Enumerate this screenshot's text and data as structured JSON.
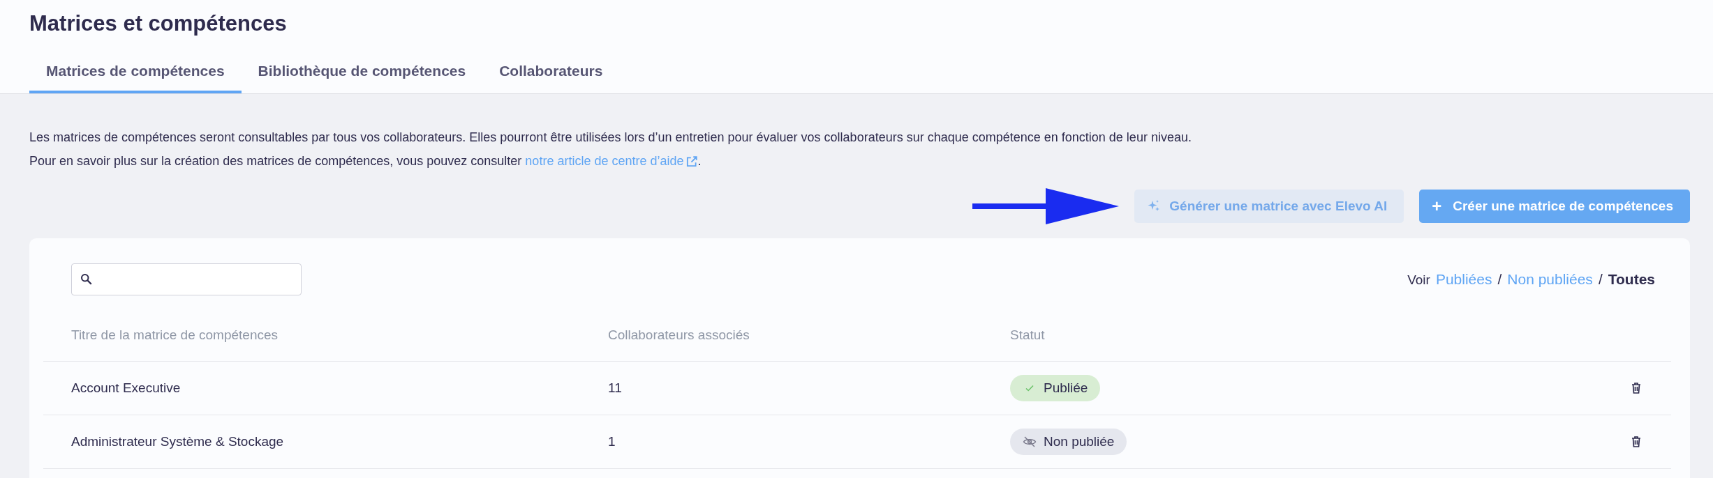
{
  "page": {
    "title": "Matrices et compétences"
  },
  "tabs": [
    {
      "label": "Matrices de compétences",
      "selected": true
    },
    {
      "label": "Bibliothèque de compétences",
      "selected": false
    },
    {
      "label": "Collaborateurs",
      "selected": false
    }
  ],
  "intro": {
    "line_1": "Les matrices de compétences seront consultables par tous vos collaborateurs. Elles pourront être utilisées lors d’un entretien pour évaluer vos collaborateurs sur chaque compétence en fonction de leur niveau.",
    "line_2": "Pour en savoir plus sur la création des matrices de compétences, vous pouvez consulter",
    "link": "notre article de centre d’aide",
    "line_end": "."
  },
  "actions": [
    {
      "kind": "ai",
      "label": "Générer une matrice avec Elevo AI"
    },
    {
      "kind": "create",
      "label": "Créer une matrice de compétences",
      "icon": "+"
    }
  ],
  "filter": {
    "label": "Voir",
    "options": [
      {
        "label": "Publiées",
        "selected": false
      },
      {
        "label": "Non publiées",
        "selected": false
      },
      {
        "label": "Toutes",
        "selected": true
      }
    ],
    "separator": "/"
  },
  "table": {
    "columns": [
      "Titre de la matrice de compétences",
      "Collaborateurs associés",
      "Statut"
    ],
    "rows": [
      {
        "title": "Account Executive",
        "count": "11",
        "status": {
          "kind": "published",
          "label": "Publiée"
        }
      },
      {
        "title": "Administrateur Système & Stockage",
        "count": "1",
        "status": {
          "kind": "unpublished",
          "label": "Non publiée"
        }
      }
    ]
  }
}
